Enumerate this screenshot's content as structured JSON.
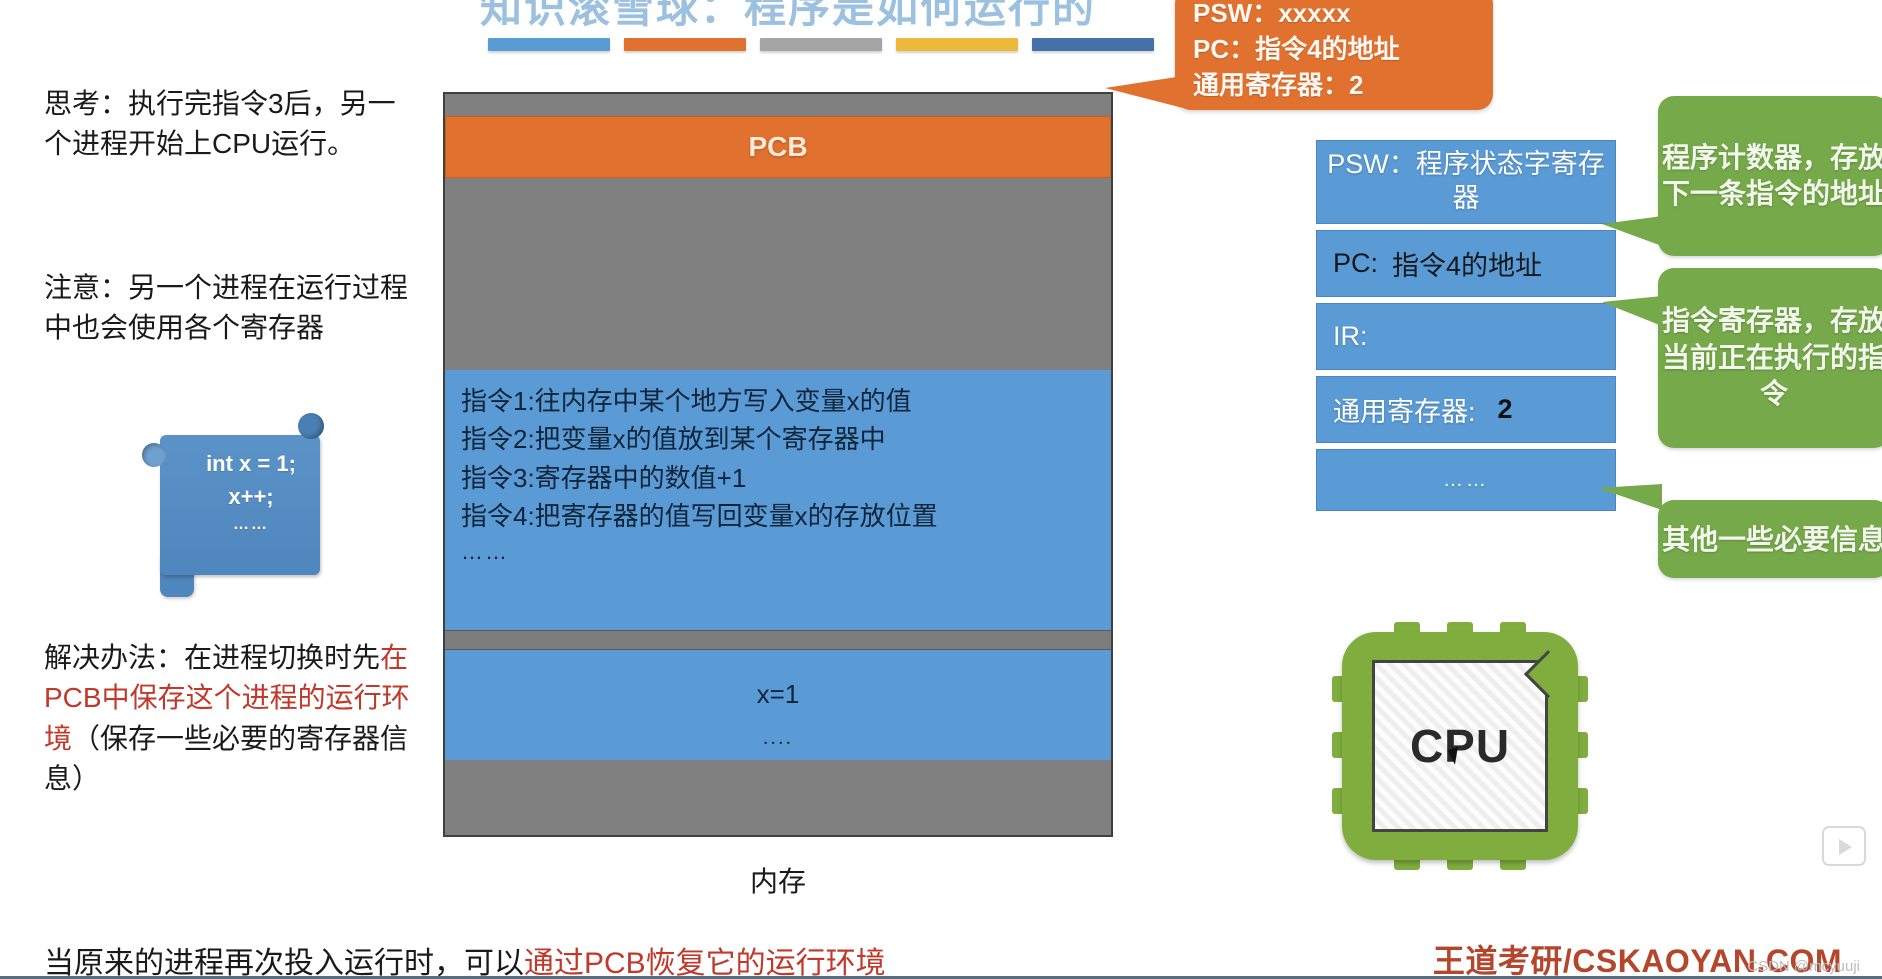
{
  "slide": {
    "title": "知识滚雪球：程序是如何运行的",
    "title_bar_colors": [
      "#5b9bd5",
      "#e0712e",
      "#a5a5a5",
      "#ecb93b",
      "#4472a8"
    ]
  },
  "left_notes": {
    "think": "思考：执行完指令3后，另一个进程开始上CPU运行。",
    "note": "注意：另一个进程在运行过程中也会使用各个寄存器",
    "solution_prefix": "解决办法：在进程切换时先",
    "solution_highlight": "在PCB中保存这个进程的运行环境",
    "solution_suffix": "（保存一些必要的寄存器信息）"
  },
  "code_scroll": {
    "line1": "int x = 1;",
    "line2": "x++;",
    "line3": "……"
  },
  "memory": {
    "caption": "内存",
    "pcb_label": "PCB",
    "instructions": [
      "指令1:往内存中某个地方写入变量x的值",
      "指令2:把变量x的值放到某个寄存器中",
      "指令3:寄存器中的数值+1",
      "指令4:把寄存器的值写回变量x的存放位置"
    ],
    "instructions_more": "……",
    "data_value": "x=1",
    "data_more": "...."
  },
  "callout_orange": {
    "line1": "PSW：xxxxx",
    "line2": "PC：指令4的地址",
    "line3": "通用寄存器：2"
  },
  "registers": [
    {
      "name": "psw",
      "label": "PSW：程序状态字寄存器",
      "value": ""
    },
    {
      "name": "pc",
      "label": "PC:",
      "value": "指令4的地址"
    },
    {
      "name": "ir",
      "label": "IR:",
      "value": ""
    },
    {
      "name": "general",
      "label": "通用寄存器:",
      "value": "2"
    },
    {
      "name": "more",
      "label": "……",
      "value": ""
    }
  ],
  "green_callouts": {
    "pc": "程序计数器，存放下一条指令的地址",
    "ir": "指令寄存器，存放当前正在执行的指令",
    "etc": "其他一些必要信息"
  },
  "cpu": {
    "label": "CPU"
  },
  "footer": {
    "text_prefix": "当原来的进程再次投入运行时，可以",
    "text_highlight": "通过PCB恢复它的运行环境",
    "brand": "王道考研/CSKAOYAN.COM",
    "watermark": "CSDN @mcyuuji"
  },
  "colors": {
    "orange": "#e0712e",
    "blue": "#5b9bd5",
    "gray": "#808080",
    "green": "#76a94a",
    "red": "#c0392b",
    "brand": "#b4462c"
  }
}
